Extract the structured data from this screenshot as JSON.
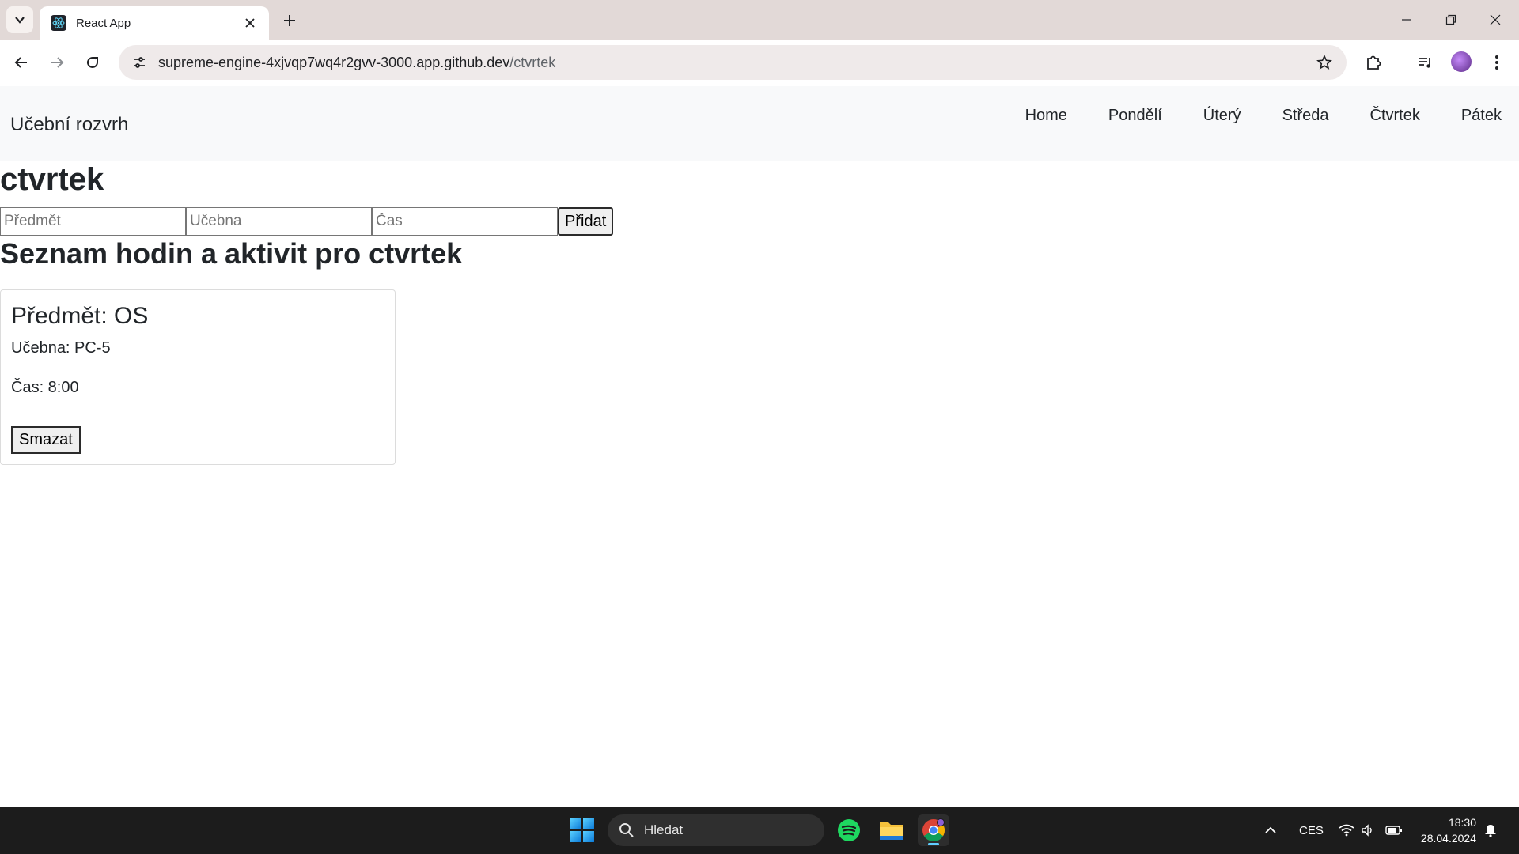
{
  "browser": {
    "tab_title": "React App",
    "url_host": "supreme-engine-4xjvqp7wq4r2gvv-3000.app.github.dev",
    "url_path": "/ctvrtek"
  },
  "navbar": {
    "brand": "Učební rozvrh",
    "links": [
      "Home",
      "Pondělí",
      "Úterý",
      "Středa",
      "Čtvrtek",
      "Pátek"
    ]
  },
  "page": {
    "day_heading": "ctvrtek",
    "list_heading": "Seznam hodin a aktivit pro ctvrtek"
  },
  "form": {
    "subject_placeholder": "Předmět",
    "room_placeholder": "Učebna",
    "time_placeholder": "Čas",
    "add_label": "Přidat"
  },
  "entries": [
    {
      "subject": "Předmět: OS",
      "room": "Učebna: PC-5",
      "time": "Čas: 8:00",
      "delete_label": "Smazat"
    }
  ],
  "taskbar": {
    "search_label": "Hledat",
    "language": "CES",
    "time": "18:30",
    "date": "28.04.2024"
  },
  "icons": {
    "tab_search": "chevron-down-icon",
    "favicon": "react-icon",
    "back": "arrow-left-icon",
    "forward": "arrow-right-icon",
    "reload": "reload-icon",
    "site_info": "tune-icon",
    "bookmark": "star-icon",
    "extensions": "puzzle-icon",
    "media": "media-queue-icon",
    "menu": "kebab-menu-icon"
  }
}
